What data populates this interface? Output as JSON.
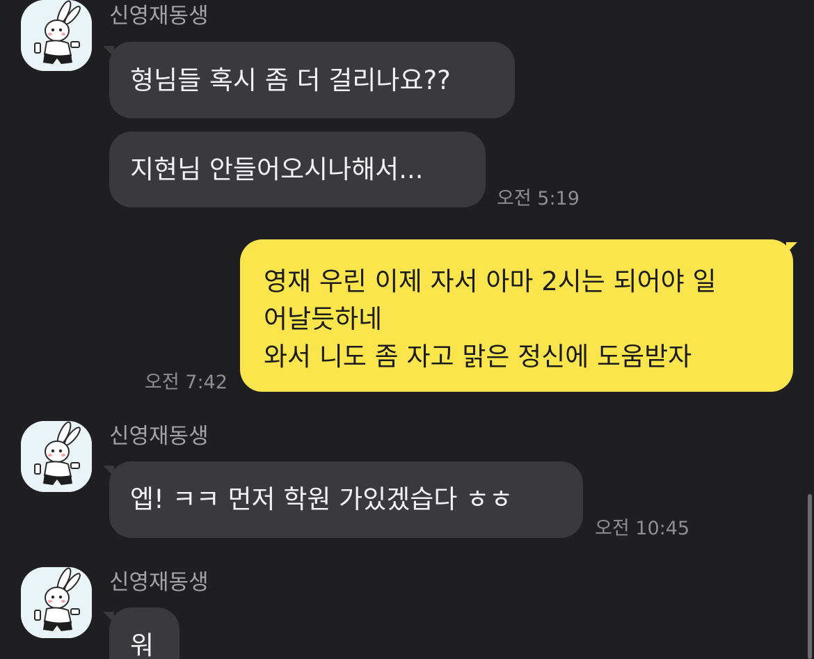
{
  "chat": {
    "groups": [
      {
        "sender": "신영재동생",
        "messages": [
          "형님들 혹시 좀 더 걸리나요??",
          "지현님 안들어오시나해서..."
        ],
        "time": "오전 5:19"
      },
      {
        "sender": "me",
        "lines": [
          "영재 우린 이제 자서 아마 2시는 되어야 일",
          "어날듯하네",
          "와서 니도 좀 자고 맑은 정신에 도움받자"
        ],
        "time": "오전 7:42"
      },
      {
        "sender": "신영재동생",
        "messages": [
          "엡! ㅋㅋ 먼저 학원 가있겠습다 ㅎㅎ"
        ],
        "time": "오전 10:45"
      },
      {
        "sender": "신영재동생",
        "messages": [
          "워"
        ]
      }
    ]
  },
  "colors": {
    "background": "#1f1f22",
    "incoming_bubble": "#3a3a3d",
    "outgoing_bubble": "#fae54d",
    "sender_name": "#a3a3a8",
    "timestamp": "#8e8e93"
  },
  "icons": {
    "avatar": "rabbit-avatar-icon"
  }
}
